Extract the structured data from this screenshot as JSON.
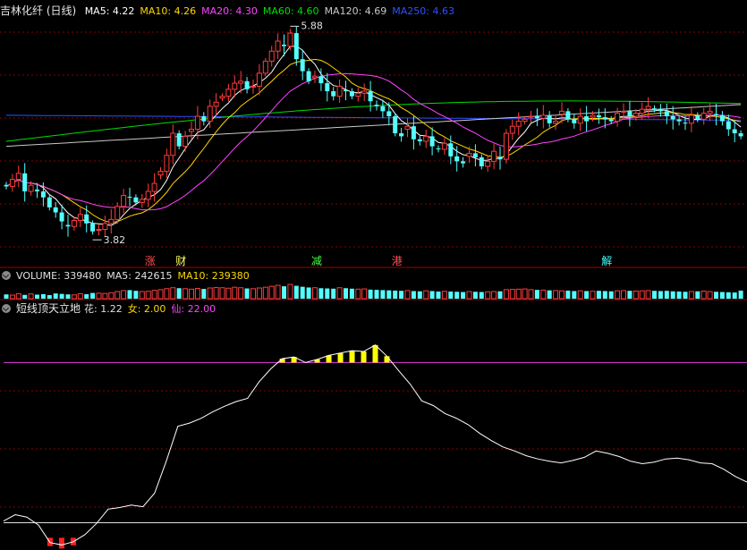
{
  "header": {
    "title": "吉林化纤 (日线)",
    "ma": [
      {
        "label": "MA5: 4.22",
        "color": "#ffffff"
      },
      {
        "label": "MA10: 4.26",
        "color": "#ffd700"
      },
      {
        "label": "MA20: 4.30",
        "color": "#ff44ff"
      },
      {
        "label": "MA60: 4.60",
        "color": "#00dd00"
      },
      {
        "label": "MA120: 4.69",
        "color": "#c8c8c8"
      },
      {
        "label": "MA250: 4.63",
        "color": "#3050ff"
      }
    ]
  },
  "volume_header": {
    "label": "VOLUME: 339480",
    "ma5": "MA5: 242615",
    "ma10": "MA10: 239380"
  },
  "indicator_header": {
    "label": "短线顶天立地",
    "hua": "花: 1.22",
    "nv": "女: 2.00",
    "xian": "仙: 22.00"
  },
  "colors": {
    "up": "#ff3c3c",
    "down": "#54ffff",
    "grid": "#8b0000",
    "line": "#ffffff",
    "top_fill": "#ffff00",
    "bottom_fill": "#ff2020",
    "level": "#cc33cc"
  },
  "chart_data": [
    {
      "type": "candlestick",
      "title": "吉林化纤 (日线)",
      "annotations": [
        {
          "text": "5.88",
          "kind": "high"
        },
        {
          "text": "3.82",
          "kind": "low"
        }
      ],
      "events": [
        {
          "text": "涨",
          "color": "#ff5050"
        },
        {
          "text": "财",
          "color": "#ffff66"
        },
        {
          "text": "减",
          "color": "#44ff44"
        },
        {
          "text": "港",
          "color": "#ff5050"
        },
        {
          "text": "解",
          "color": "#44ffff"
        }
      ],
      "ylim": [
        3.55,
        6.05
      ],
      "close": [
        4.35,
        4.42,
        4.48,
        4.3,
        4.36,
        4.3,
        4.24,
        4.14,
        4.09,
        4.0,
        3.95,
        4.01,
        4.07,
        3.98,
        3.9,
        3.92,
        3.98,
        4.02,
        4.15,
        4.26,
        4.24,
        4.19,
        4.22,
        4.3,
        4.38,
        4.5,
        4.66,
        4.88,
        4.75,
        4.85,
        4.92,
        5.05,
        5.0,
        5.15,
        5.19,
        5.25,
        5.32,
        5.38,
        5.4,
        5.32,
        5.35,
        5.48,
        5.6,
        5.7,
        5.8,
        5.75,
        5.88,
        5.62,
        5.5,
        5.4,
        5.45,
        5.38,
        5.3,
        5.25,
        5.35,
        5.3,
        5.25,
        5.28,
        5.3,
        5.2,
        5.15,
        5.1,
        5.05,
        4.88,
        4.85,
        4.95,
        4.82,
        4.8,
        4.85,
        4.75,
        4.72,
        4.78,
        4.65,
        4.6,
        4.58,
        4.68,
        4.64,
        4.55,
        4.6,
        4.7,
        4.62,
        4.88,
        4.95,
        5.0,
        5.02,
        5.05,
        5.03,
        5.06,
        4.98,
        5.0,
        5.1,
        5.02,
        4.98,
        5.05,
        5.0,
        5.06,
        5.04,
        5.02,
        5.0,
        5.08,
        5.1,
        5.05,
        5.08,
        5.12,
        5.15,
        5.12,
        5.1,
        5.05,
        5.02,
        5.0,
        4.98,
        5.06,
        5.02,
        5.08,
        5.1,
        5.06,
        5.0,
        4.92,
        4.88,
        4.85
      ],
      "volume": [
        180,
        150,
        210,
        160,
        200,
        170,
        190,
        150,
        220,
        200,
        180,
        160,
        210,
        190,
        240,
        230,
        220,
        250,
        300,
        340,
        360,
        330,
        300,
        310,
        350,
        380,
        420,
        460,
        440,
        420,
        400,
        430,
        410,
        450,
        470,
        460,
        440,
        480,
        460,
        430,
        420,
        450,
        480,
        520,
        560,
        520,
        600,
        540,
        500,
        470,
        460,
        440,
        430,
        420,
        460,
        440,
        420,
        400,
        410,
        380,
        370,
        360,
        350,
        340,
        330,
        340,
        320,
        310,
        330,
        320,
        300,
        310,
        300,
        290,
        280,
        300,
        290,
        280,
        290,
        300,
        310,
        380,
        390,
        400,
        410,
        380,
        370,
        360,
        350,
        340,
        330,
        340,
        320,
        330,
        320,
        310,
        330,
        320,
        310,
        330,
        340,
        330,
        320,
        330,
        340,
        330,
        320,
        330,
        310,
        300,
        290,
        300,
        310,
        320,
        300,
        290,
        280,
        270,
        260,
        340
      ]
    },
    {
      "type": "line",
      "title": "短线顶天立地",
      "levels": [
        2,
        22
      ],
      "ylim": [
        -1.2,
        28
      ],
      "values": [
        2.1,
        2.9,
        2.6,
        1.6,
        -0.6,
        -0.9,
        -0.5,
        0.4,
        1.8,
        3.6,
        3.8,
        4.1,
        3.9,
        5.6,
        9.6,
        14.0,
        14.4,
        15.0,
        15.8,
        16.5,
        17.1,
        17.5,
        19.6,
        21.2,
        22.5,
        22.7,
        22.0,
        22.4,
        22.9,
        23.2,
        23.5,
        23.4,
        24.2,
        22.8,
        21.0,
        19.3,
        17.2,
        16.6,
        15.6,
        15.0,
        14.2,
        13.1,
        12.2,
        11.4,
        10.9,
        10.3,
        9.9,
        9.6,
        9.4,
        9.7,
        10.1,
        10.9,
        10.6,
        10.2,
        9.6,
        9.3,
        9.5,
        9.9,
        10.0,
        9.8,
        9.4,
        9.3,
        8.6,
        7.7,
        7.0
      ]
    }
  ]
}
